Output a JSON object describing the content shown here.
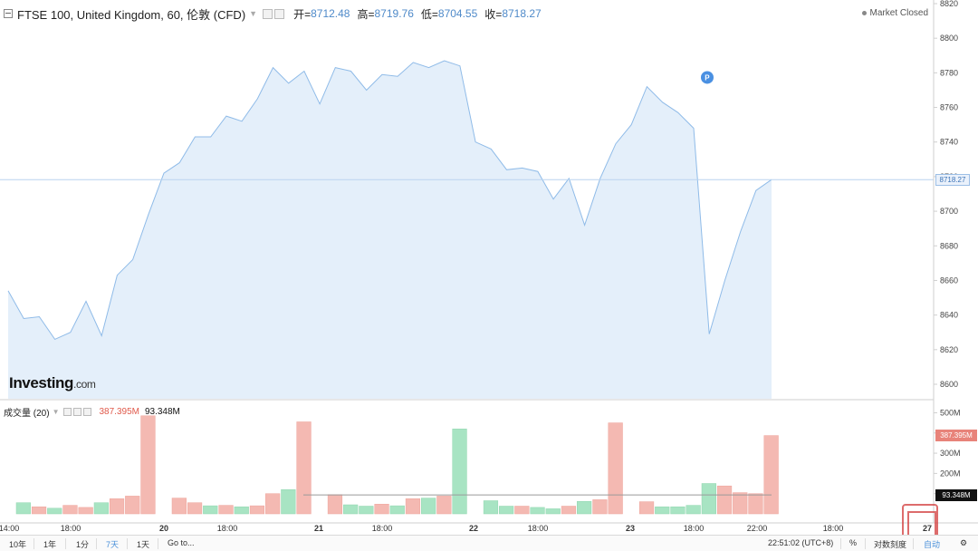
{
  "header": {
    "symbol": "FTSE 100, United Kingdom, 60, 伦敦 (CFD)",
    "open_label": "开=",
    "open": "8712.48",
    "high_label": "高=",
    "high": "8719.76",
    "low_label": "低=",
    "low": "8704.55",
    "close_label": "收=",
    "close": "8718.27",
    "status": "Market Closed"
  },
  "logo": {
    "brand": "Investing",
    "suffix": ".com"
  },
  "volume_legend": {
    "label": "成交量 (20)",
    "value_red": "387.395M",
    "value_black": "93.348M"
  },
  "tags": {
    "price": "8718.27",
    "vol_red": "387.395M",
    "vol_black": "93.348M"
  },
  "bottombar": {
    "ranges": [
      "10年",
      "1年",
      "1分",
      "7天",
      "1天"
    ],
    "active_range": "7天",
    "goto": "Go to...",
    "time": "22:51:02 (UTC+8)",
    "percent": "%",
    "log_scale": "对数刻度",
    "auto": "自动"
  },
  "colors": {
    "line": "#8fbbe8",
    "area": "#e4effa",
    "up": "#a8e4c3",
    "down": "#f4b9b2",
    "axis_text": "#444",
    "price_marker": "#4a90e2"
  },
  "chart_data": [
    {
      "type": "area",
      "name": "price",
      "y_ticks": [
        8600,
        8620,
        8640,
        8660,
        8680,
        8700,
        8720,
        8740,
        8760,
        8780,
        8800,
        8820
      ],
      "ylim": [
        8590,
        8822
      ],
      "last_value": 8718.27,
      "values": [
        8654,
        8638,
        8639,
        8626,
        8630,
        8648,
        8628,
        8663,
        8672,
        8698,
        8722,
        8728,
        8743,
        8743,
        8755,
        8752,
        8765,
        8783,
        8774,
        8781,
        8762,
        8783,
        8781,
        8770,
        8779,
        8778,
        8786,
        8783,
        8787,
        8784,
        8740,
        8736,
        8724,
        8725,
        8723,
        8707,
        8719,
        8692,
        8719,
        8739,
        8750,
        8772,
        8763,
        8757,
        8748,
        8629,
        8660,
        8688,
        8712,
        8718.27
      ],
      "marker": {
        "label": "P",
        "index": 44,
        "value": 8770
      }
    },
    {
      "type": "bar",
      "name": "volume",
      "y_ticks": [
        "100M",
        "200M",
        "300M",
        "400M",
        "500M"
      ],
      "tick_values": [
        100,
        200,
        300,
        400,
        500
      ],
      "ylim": [
        0,
        520
      ],
      "unit": "M",
      "bars": [
        {
          "v": 55,
          "c": "up"
        },
        {
          "v": 35,
          "c": "down"
        },
        {
          "v": 28,
          "c": "up"
        },
        {
          "v": 42,
          "c": "down"
        },
        {
          "v": 32,
          "c": "down"
        },
        {
          "v": 55,
          "c": "up"
        },
        {
          "v": 75,
          "c": "down"
        },
        {
          "v": 88,
          "c": "down"
        },
        {
          "v": 485,
          "c": "down"
        },
        {
          "v": 0,
          "c": "down"
        },
        {
          "v": 78,
          "c": "down"
        },
        {
          "v": 55,
          "c": "down"
        },
        {
          "v": 40,
          "c": "up"
        },
        {
          "v": 42,
          "c": "down"
        },
        {
          "v": 35,
          "c": "up"
        },
        {
          "v": 40,
          "c": "down"
        },
        {
          "v": 100,
          "c": "down"
        },
        {
          "v": 120,
          "c": "up"
        },
        {
          "v": 455,
          "c": "down"
        },
        {
          "v": 0,
          "c": "down"
        },
        {
          "v": 95,
          "c": "down"
        },
        {
          "v": 45,
          "c": "up"
        },
        {
          "v": 38,
          "c": "up"
        },
        {
          "v": 48,
          "c": "down"
        },
        {
          "v": 40,
          "c": "up"
        },
        {
          "v": 75,
          "c": "down"
        },
        {
          "v": 78,
          "c": "up"
        },
        {
          "v": 88,
          "c": "down"
        },
        {
          "v": 420,
          "c": "up"
        },
        {
          "v": 0,
          "c": "down"
        },
        {
          "v": 65,
          "c": "up"
        },
        {
          "v": 38,
          "c": "up"
        },
        {
          "v": 38,
          "c": "down"
        },
        {
          "v": 32,
          "c": "up"
        },
        {
          "v": 25,
          "c": "up"
        },
        {
          "v": 38,
          "c": "down"
        },
        {
          "v": 62,
          "c": "up"
        },
        {
          "v": 70,
          "c": "down"
        },
        {
          "v": 450,
          "c": "down"
        },
        {
          "v": 0,
          "c": "down"
        },
        {
          "v": 60,
          "c": "down"
        },
        {
          "v": 35,
          "c": "up"
        },
        {
          "v": 35,
          "c": "up"
        },
        {
          "v": 42,
          "c": "up"
        },
        {
          "v": 150,
          "c": "up"
        },
        {
          "v": 138,
          "c": "down"
        },
        {
          "v": 105,
          "c": "down"
        },
        {
          "v": 100,
          "c": "down"
        },
        {
          "v": 387.395,
          "c": "down"
        }
      ],
      "moving_average": 93.348
    }
  ],
  "x_axis": {
    "labels": [
      "14:00",
      "18:00",
      "20",
      "18:00",
      "21",
      "18:00",
      "22",
      "18:00",
      "23",
      "18:00",
      "22:00",
      "18:00",
      "27"
    ],
    "bold": [
      "20",
      "21",
      "22",
      "23",
      "27"
    ]
  }
}
